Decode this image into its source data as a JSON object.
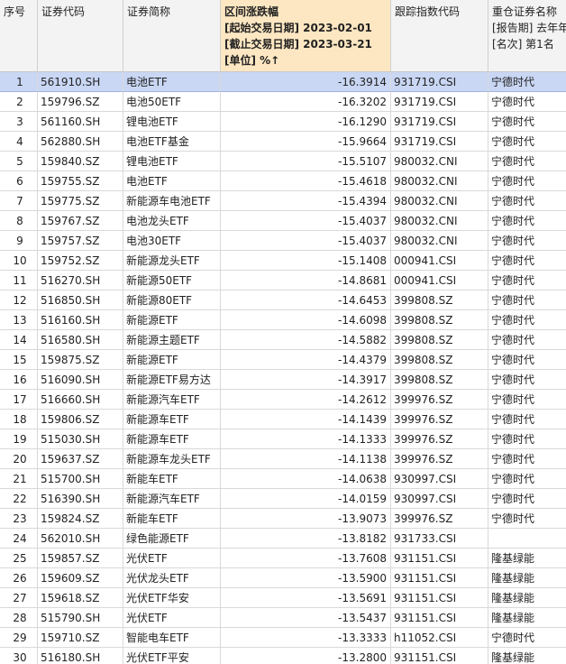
{
  "headers": {
    "seq": "序号",
    "code": "证券代码",
    "name": "证券简称",
    "change": [
      "区间涨跌幅",
      "[起始交易日期] 2023-02-01",
      "[截止交易日期] 2023-03-21",
      "[单位] %↑"
    ],
    "index": "跟踪指数代码",
    "top_holding": [
      "重仓证券名称",
      "[报告期] 去年年报",
      "[名次] 第1名"
    ]
  },
  "rows": [
    {
      "seq": "1",
      "code": "561910.SH",
      "name": "电池ETF",
      "change": "-16.3914",
      "index": "931719.CSI",
      "top": "宁德时代"
    },
    {
      "seq": "2",
      "code": "159796.SZ",
      "name": "电池50ETF",
      "change": "-16.3202",
      "index": "931719.CSI",
      "top": "宁德时代"
    },
    {
      "seq": "3",
      "code": "561160.SH",
      "name": "锂电池ETF",
      "change": "-16.1290",
      "index": "931719.CSI",
      "top": "宁德时代"
    },
    {
      "seq": "4",
      "code": "562880.SH",
      "name": "电池ETF基金",
      "change": "-15.9664",
      "index": "931719.CSI",
      "top": "宁德时代"
    },
    {
      "seq": "5",
      "code": "159840.SZ",
      "name": "锂电池ETF",
      "change": "-15.5107",
      "index": "980032.CNI",
      "top": "宁德时代"
    },
    {
      "seq": "6",
      "code": "159755.SZ",
      "name": "电池ETF",
      "change": "-15.4618",
      "index": "980032.CNI",
      "top": "宁德时代"
    },
    {
      "seq": "7",
      "code": "159775.SZ",
      "name": "新能源车电池ETF",
      "change": "-15.4394",
      "index": "980032.CNI",
      "top": "宁德时代"
    },
    {
      "seq": "8",
      "code": "159767.SZ",
      "name": "电池龙头ETF",
      "change": "-15.4037",
      "index": "980032.CNI",
      "top": "宁德时代"
    },
    {
      "seq": "9",
      "code": "159757.SZ",
      "name": "电池30ETF",
      "change": "-15.4037",
      "index": "980032.CNI",
      "top": "宁德时代"
    },
    {
      "seq": "10",
      "code": "159752.SZ",
      "name": "新能源龙头ETF",
      "change": "-15.1408",
      "index": "000941.CSI",
      "top": "宁德时代"
    },
    {
      "seq": "11",
      "code": "516270.SH",
      "name": "新能源50ETF",
      "change": "-14.8681",
      "index": "000941.CSI",
      "top": "宁德时代"
    },
    {
      "seq": "12",
      "code": "516850.SH",
      "name": "新能源80ETF",
      "change": "-14.6453",
      "index": "399808.SZ",
      "top": "宁德时代"
    },
    {
      "seq": "13",
      "code": "516160.SH",
      "name": "新能源ETF",
      "change": "-14.6098",
      "index": "399808.SZ",
      "top": "宁德时代"
    },
    {
      "seq": "14",
      "code": "516580.SH",
      "name": "新能源主题ETF",
      "change": "-14.5882",
      "index": "399808.SZ",
      "top": "宁德时代"
    },
    {
      "seq": "15",
      "code": "159875.SZ",
      "name": "新能源ETF",
      "change": "-14.4379",
      "index": "399808.SZ",
      "top": "宁德时代"
    },
    {
      "seq": "16",
      "code": "516090.SH",
      "name": "新能源ETF易方达",
      "change": "-14.3917",
      "index": "399808.SZ",
      "top": "宁德时代"
    },
    {
      "seq": "17",
      "code": "516660.SH",
      "name": "新能源汽车ETF",
      "change": "-14.2612",
      "index": "399976.SZ",
      "top": "宁德时代"
    },
    {
      "seq": "18",
      "code": "159806.SZ",
      "name": "新能源车ETF",
      "change": "-14.1439",
      "index": "399976.SZ",
      "top": "宁德时代"
    },
    {
      "seq": "19",
      "code": "515030.SH",
      "name": "新能源车ETF",
      "change": "-14.1333",
      "index": "399976.SZ",
      "top": "宁德时代"
    },
    {
      "seq": "20",
      "code": "159637.SZ",
      "name": "新能源车龙头ETF",
      "change": "-14.1138",
      "index": "399976.SZ",
      "top": "宁德时代"
    },
    {
      "seq": "21",
      "code": "515700.SH",
      "name": "新能车ETF",
      "change": "-14.0638",
      "index": "930997.CSI",
      "top": "宁德时代"
    },
    {
      "seq": "22",
      "code": "516390.SH",
      "name": "新能源汽车ETF",
      "change": "-14.0159",
      "index": "930997.CSI",
      "top": "宁德时代"
    },
    {
      "seq": "23",
      "code": "159824.SZ",
      "name": "新能车ETF",
      "change": "-13.9073",
      "index": "399976.SZ",
      "top": "宁德时代"
    },
    {
      "seq": "24",
      "code": "562010.SH",
      "name": "绿色能源ETF",
      "change": "-13.8182",
      "index": "931733.CSI",
      "top": ""
    },
    {
      "seq": "25",
      "code": "159857.SZ",
      "name": "光伏ETF",
      "change": "-13.7608",
      "index": "931151.CSI",
      "top": "隆基绿能"
    },
    {
      "seq": "26",
      "code": "159609.SZ",
      "name": "光伏龙头ETF",
      "change": "-13.5900",
      "index": "931151.CSI",
      "top": "隆基绿能"
    },
    {
      "seq": "27",
      "code": "159618.SZ",
      "name": "光伏ETF华安",
      "change": "-13.5691",
      "index": "931151.CSI",
      "top": "隆基绿能"
    },
    {
      "seq": "28",
      "code": "515790.SH",
      "name": "光伏ETF",
      "change": "-13.5437",
      "index": "931151.CSI",
      "top": "隆基绿能"
    },
    {
      "seq": "29",
      "code": "159710.SZ",
      "name": "智能电车ETF",
      "change": "-13.3333",
      "index": "h11052.CSI",
      "top": "宁德时代"
    },
    {
      "seq": "30",
      "code": "516180.SH",
      "name": "光伏ETF平安",
      "change": "-13.2800",
      "index": "931151.CSI",
      "top": "隆基绿能"
    }
  ],
  "selected_row": "1",
  "colors": {
    "selection": "#c9d7f4",
    "header_highlight": "#fde7c2",
    "header_bg": "#f3f3f3",
    "grid": "#d9d9d9"
  }
}
